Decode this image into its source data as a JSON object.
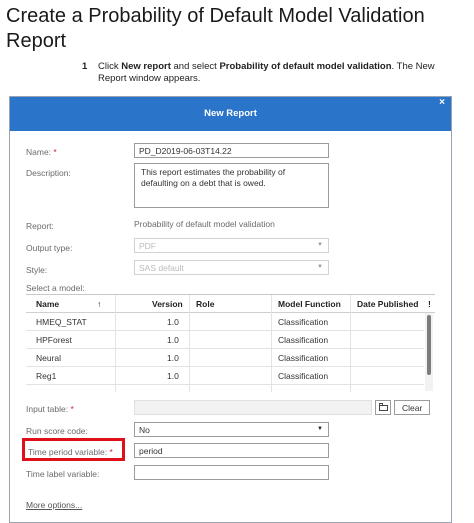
{
  "doc": {
    "title": "Create a Probability of Default Model Validation Report",
    "step_number": "1",
    "step_text_1": "Click ",
    "step_bold_1": "New report",
    "step_text_2": " and select ",
    "step_bold_2": "Probability of default model validation",
    "step_text_3": ". The New Report window appears."
  },
  "dialog": {
    "title": "New Report",
    "close": "×",
    "name_label": "Name:",
    "required_mark": "*",
    "name_value": "PD_D2019-06-03T14.22",
    "description_label": "Description:",
    "description_value": "This report estimates the probability of defaulting on a debt that is owed.",
    "report_label": "Report:",
    "report_value": "Probability of default model validation",
    "output_type_label": "Output type:",
    "output_type_value": "PDF",
    "style_label": "Style:",
    "style_value": "SAS default",
    "select_model_label": "Select a model:",
    "table": {
      "headers": [
        "Name",
        "Version",
        "Role",
        "Model Function",
        "Date Published"
      ],
      "sort_arrow": "↑",
      "header_extra": "!",
      "rows": [
        {
          "name": "HMEQ_STAT",
          "version": "1.0",
          "role": "",
          "function": "Classification",
          "date": ""
        },
        {
          "name": "HPForest",
          "version": "1.0",
          "role": "",
          "function": "Classification",
          "date": ""
        },
        {
          "name": "Neural",
          "version": "1.0",
          "role": "",
          "function": "Classification",
          "date": ""
        },
        {
          "name": "Reg1",
          "version": "1.0",
          "role": "",
          "function": "Classification",
          "date": ""
        }
      ]
    },
    "input_table_label": "Input table:",
    "clear_button": "Clear",
    "run_score_label": "Run score code:",
    "run_score_value": "No",
    "time_period_label": "Time period variable:",
    "time_period_value": "period",
    "time_label_label": "Time label variable:",
    "time_label_value": "",
    "more_options": "More options..."
  },
  "colors": {
    "titlebar": "#2a74c9",
    "highlight": "#e0101a"
  }
}
